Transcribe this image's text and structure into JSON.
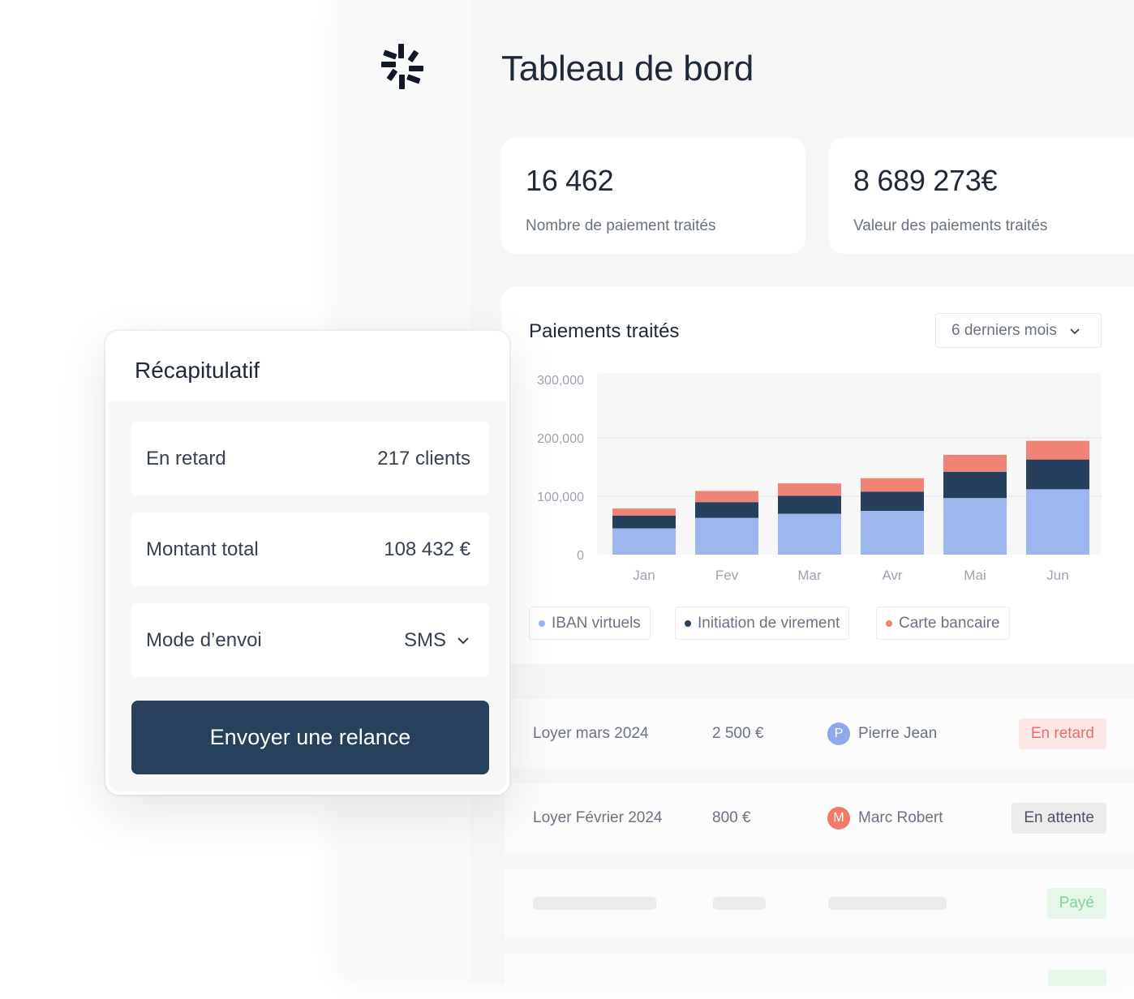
{
  "page": {
    "title": "Tableau de bord"
  },
  "stats": [
    {
      "value": "16 462",
      "label": "Nombre de paiement traités"
    },
    {
      "value": "8 689 273€",
      "label": "Valeur des paiements traités"
    }
  ],
  "chart_card": {
    "title": "Paiements traités",
    "period": "6 derniers mois"
  },
  "chart_data": {
    "type": "bar",
    "stacked": true,
    "categories": [
      "Jan",
      "Fev",
      "Mar",
      "Avr",
      "Mai",
      "Jun"
    ],
    "y_ticks": [
      "300,000",
      "200,000",
      "100,000",
      "0"
    ],
    "ylim": [
      0,
      300000
    ],
    "series": [
      {
        "name": "IBAN virtuels",
        "color": "#9db6ee",
        "values": [
          45000,
          63000,
          70000,
          75000,
          97000,
          112000
        ]
      },
      {
        "name": "Initiation de virement",
        "color": "#253f5c",
        "values": [
          22000,
          27000,
          31000,
          33000,
          45000,
          51000
        ]
      },
      {
        "name": "Carte bancaire",
        "color": "#ef8376",
        "values": [
          12000,
          19000,
          21000,
          23000,
          29000,
          32000
        ]
      }
    ],
    "grid": true,
    "legend_position": "bottom"
  },
  "payments": [
    {
      "ref": "Loyer mars 2024",
      "amount": "2 500 €",
      "avatar": "P",
      "avatar_color": "#8fa8ea",
      "person": "Pierre Jean",
      "status": "En retard",
      "status_bg": "#fde8e8",
      "status_color": "#ec6b6b"
    },
    {
      "ref": "Loyer Février 2024",
      "amount": "800 €",
      "avatar": "M",
      "avatar_color": "#ee7b68",
      "person": "Marc Robert",
      "status": "En attente",
      "status_bg": "#ececec",
      "status_color": "#4b5563"
    }
  ],
  "placeholder_row": {
    "status": "Payé",
    "status_bg": "#e6f7ea",
    "status_color": "#7fd49a"
  },
  "recap": {
    "title": "Récapitulatif",
    "rows": [
      {
        "label": "En retard",
        "value": "217 clients"
      },
      {
        "label": "Montant total",
        "value": "108 432 €"
      },
      {
        "label": "Mode d’envoi",
        "value": "SMS"
      }
    ],
    "button": "Envoyer une relance"
  }
}
